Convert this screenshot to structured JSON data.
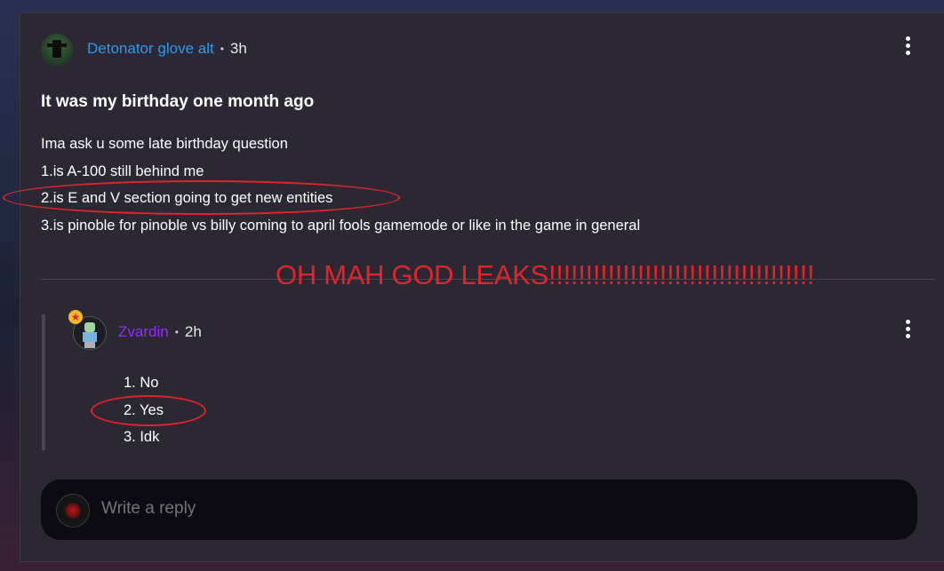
{
  "post": {
    "author": "Detonator glove alt",
    "separator": "•",
    "time": "3h",
    "title": "It was my birthday one month ago",
    "body": [
      "Ima ask u some late birthday question",
      "1.is A-100 still behind me",
      "2.is E and V section going to get new entities",
      "3.is pinoble for pinoble vs billy coming to april fools gamemode or like in the game in general"
    ]
  },
  "reply": {
    "author": "Zvardin",
    "separator": "•",
    "time": "2h",
    "badge_icon": "★",
    "items": [
      "1. No",
      "2. Yes",
      "3. Idk"
    ]
  },
  "reply_box": {
    "placeholder": "Write a reply"
  },
  "annotation": {
    "text": "OH MAH GOD LEAKS!!!!!!!!!!!!!!!!!!!!!!!!!!!!!!!!!!!!",
    "color": "#e1262b"
  },
  "colors": {
    "author_post": "#2d9bf0",
    "author_reply": "#9a2cff",
    "panel": "#2b2733",
    "reply_box": "#0c0a13"
  }
}
